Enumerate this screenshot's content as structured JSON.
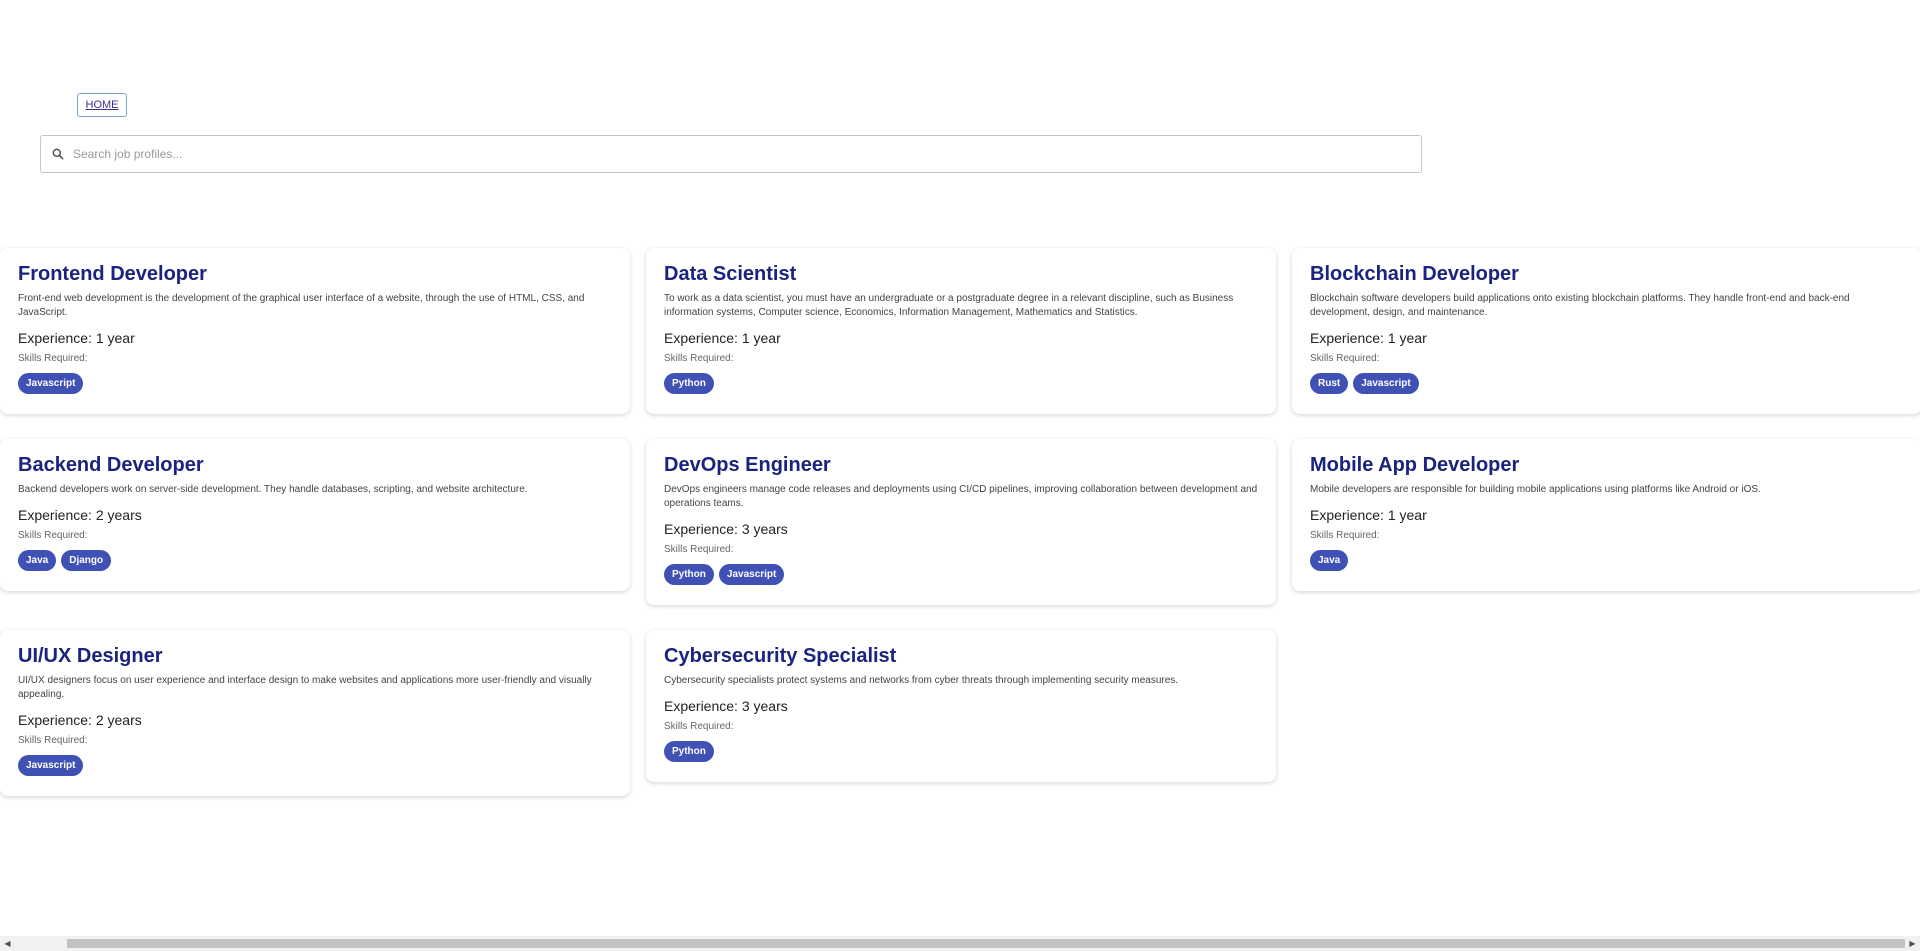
{
  "nav": {
    "home_label": "HOME"
  },
  "search": {
    "placeholder": "Search job profiles..."
  },
  "jobs": [
    {
      "title": "Frontend Developer",
      "description": "Front-end web development is the development of the graphical user interface of a website, through the use of HTML, CSS, and JavaScript.",
      "experience": "Experience: 1 year",
      "skills_label": "Skills Required:",
      "skills": [
        "Javascript"
      ]
    },
    {
      "title": "Data Scientist",
      "description": "To work as a data scientist, you must have an undergraduate or a postgraduate degree in a relevant discipline, such as Business information systems, Computer science, Economics, Information Management, Mathematics and Statistics.",
      "experience": "Experience: 1 year",
      "skills_label": "Skills Required:",
      "skills": [
        "Python"
      ]
    },
    {
      "title": "Blockchain Developer",
      "description": "Blockchain software developers build applications onto existing blockchain platforms. They handle front-end and back-end development, design, and maintenance.",
      "experience": "Experience: 1 year",
      "skills_label": "Skills Required:",
      "skills": [
        "Rust",
        "Javascript"
      ]
    },
    {
      "title": "Backend Developer",
      "description": "Backend developers work on server-side development. They handle databases, scripting, and website architecture.",
      "experience": "Experience: 2 years",
      "skills_label": "Skills Required:",
      "skills": [
        "Java",
        "Django"
      ]
    },
    {
      "title": "DevOps Engineer",
      "description": "DevOps engineers manage code releases and deployments using CI/CD pipelines, improving collaboration between development and operations teams.",
      "experience": "Experience: 3 years",
      "skills_label": "Skills Required:",
      "skills": [
        "Python",
        "Javascript"
      ]
    },
    {
      "title": "Mobile App Developer",
      "description": "Mobile developers are responsible for building mobile applications using platforms like Android or iOS.",
      "experience": "Experience: 1 year",
      "skills_label": "Skills Required:",
      "skills": [
        "Java"
      ]
    },
    {
      "title": "UI/UX Designer",
      "description": "UI/UX designers focus on user experience and interface design to make websites and applications more user-friendly and visually appealing.",
      "experience": "Experience: 2 years",
      "skills_label": "Skills Required:",
      "skills": [
        "Javascript"
      ]
    },
    {
      "title": "Cybersecurity Specialist",
      "description": "Cybersecurity specialists protect systems and networks from cyber threats through implementing security measures.",
      "experience": "Experience: 3 years",
      "skills_label": "Skills Required:",
      "skills": [
        "Python"
      ]
    }
  ],
  "icons": {
    "search": "search-icon",
    "scroll_left": "chevron-left-icon",
    "scroll_right": "chevron-right-icon"
  },
  "colors": {
    "title": "#1a237e",
    "chip": "#3f51b5",
    "home_border": "#7aa4d6"
  }
}
